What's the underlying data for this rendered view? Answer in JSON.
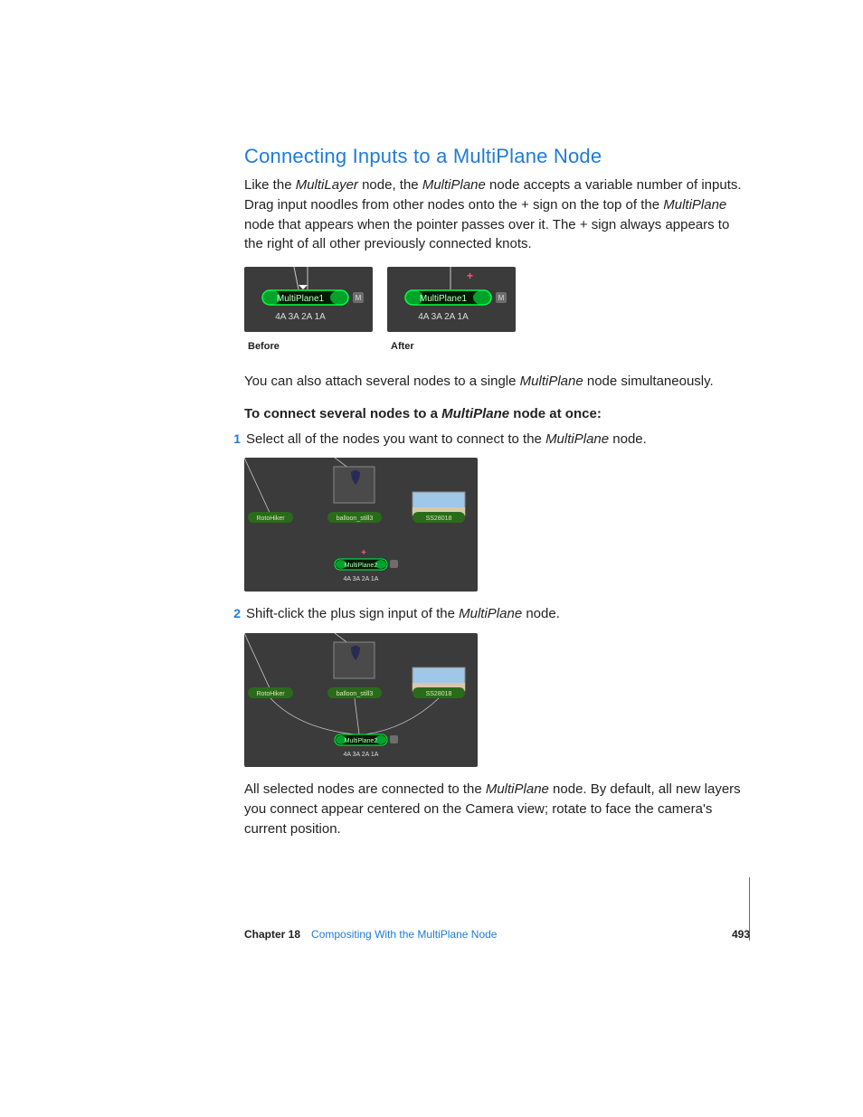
{
  "heading": "Connecting Inputs to a MultiPlane Node",
  "intro": {
    "p1a": "Like the ",
    "p1b": "MultiLayer",
    "p1c": " node, the ",
    "p1d": "MultiPlane",
    "p1e": " node accepts a variable number of inputs. Drag input noodles from other nodes onto the + sign on the top of the ",
    "p1f": "MultiPlane",
    "p1g": " node that appears when the pointer passes over it. The + sign always appears to the right of all other previously connected knots."
  },
  "captions": {
    "before": "Before",
    "after": "After"
  },
  "node_labels": {
    "name": "MultiPlane1",
    "ports": "4A 3A 2A 1A",
    "m": "M"
  },
  "p2": {
    "a": "You can also attach several nodes to a single ",
    "b": "MultiPlane",
    "c": " node simultaneously."
  },
  "instruction": {
    "a": "To connect several nodes to a ",
    "b": "MultiPlane",
    "c": " node at once:"
  },
  "steps": {
    "s1": {
      "num": "1",
      "a": "Select all of the nodes you want to connect to the ",
      "b": "MultiPlane",
      "c": " node."
    },
    "s2": {
      "num": "2",
      "a": "Shift-click the plus sign input of the ",
      "b": "MultiPlane",
      "c": " node."
    }
  },
  "figure_nodes": {
    "roto": "RotoHiker",
    "balloon": "balloon_still3",
    "sky": "SS28018",
    "multi": "MultiPlane2",
    "ports": "4A 3A 2A 1A"
  },
  "p3": {
    "a": "All selected nodes are connected to the ",
    "b": "MultiPlane",
    "c": " node. By default, all new layers you connect appear centered on the Camera view; rotate to face the camera's current position."
  },
  "footer": {
    "chapter": "Chapter 18",
    "title": "Compositing With the MultiPlane Node",
    "page": "493"
  }
}
